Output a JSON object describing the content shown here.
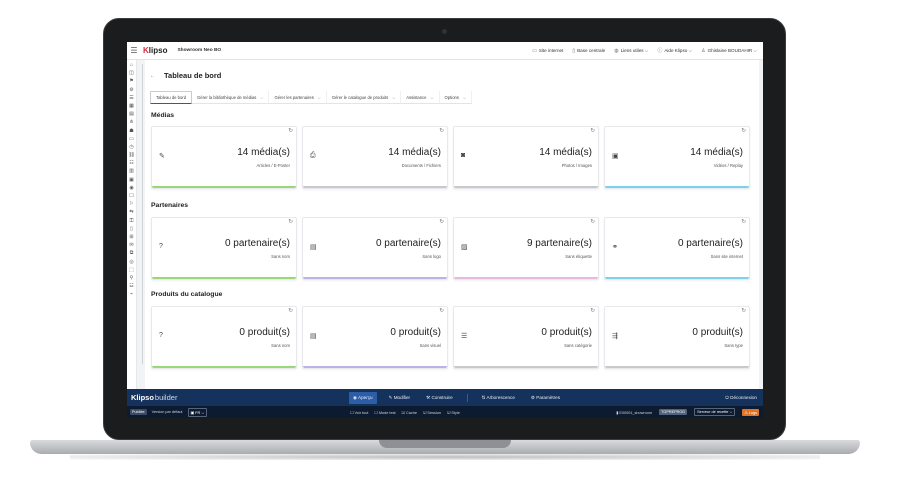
{
  "topbar": {
    "logo_k": "K",
    "logo_rest": "lipso",
    "site_name": "Showroom Neo BO",
    "links": [
      {
        "icon": "monitor-icon",
        "glyph": "▭",
        "label": "Site internet"
      },
      {
        "icon": "file-icon",
        "glyph": "▯",
        "label": "Base centrale"
      },
      {
        "icon": "globe-icon",
        "glyph": "◍",
        "label": "Liens utiles ⌵"
      },
      {
        "icon": "help-icon",
        "glyph": "ⓘ",
        "label": "Aide Klipso ⌵"
      },
      {
        "icon": "user-icon",
        "glyph": "♙",
        "label": "Ghislaine BOUDAHIR ⌵"
      }
    ]
  },
  "page": {
    "back_glyph": "←",
    "title": "Tableau de bord",
    "tabs": [
      {
        "label": "Tableau de bord",
        "active": true,
        "chevron": ""
      },
      {
        "label": "Gérer la bibliothèque de médias",
        "active": false,
        "chevron": "⌵"
      },
      {
        "label": "Gérer les partenaires",
        "active": false,
        "chevron": "⌵"
      },
      {
        "label": "Gérer le catalogue de produits",
        "active": false,
        "chevron": "⌵"
      },
      {
        "label": "Assistance",
        "active": false,
        "chevron": "⌵"
      },
      {
        "label": "Options",
        "active": false,
        "chevron": "⌵"
      }
    ]
  },
  "sections": [
    {
      "title": "Médias",
      "cards": [
        {
          "icon": "document-edit-icon",
          "glyph": "✎",
          "count": "14 média(s)",
          "sub": "Articles / E-Poster",
          "color": "#9bd77a"
        },
        {
          "icon": "file-search-icon",
          "glyph": "⎙",
          "count": "14 média(s)",
          "sub": "Documents / Fichiers",
          "color": "#c8c9cc"
        },
        {
          "icon": "camera-icon",
          "glyph": "◙",
          "count": "14 média(s)",
          "sub": "Photos / Images",
          "color": "#c8c9cc"
        },
        {
          "icon": "video-icon",
          "glyph": "▣",
          "count": "14 média(s)",
          "sub": "Vidéos / Replay",
          "color": "#7dd1ea"
        }
      ]
    },
    {
      "title": "Partenaires",
      "cards": [
        {
          "icon": "question-icon",
          "glyph": "?",
          "count": "0 partenaire(s)",
          "sub": "Sans nom",
          "color": "#9bd77a"
        },
        {
          "icon": "image-edit-icon",
          "glyph": "▤",
          "count": "0 partenaire(s)",
          "sub": "Sans logo",
          "color": "#b9b3e8"
        },
        {
          "icon": "no-image-icon",
          "glyph": "▨",
          "count": "9 partenaire(s)",
          "sub": "Sans étiquette",
          "color": "#e8b9e0"
        },
        {
          "icon": "link-off-icon",
          "glyph": "⚭",
          "count": "0 partenaire(s)",
          "sub": "Sans site internet",
          "color": "#7dd1ea"
        }
      ]
    },
    {
      "title": "Produits du catalogue",
      "cards": [
        {
          "icon": "question-icon",
          "glyph": "?",
          "count": "0 produit(s)",
          "sub": "Sans nom",
          "color": "#9bd77a"
        },
        {
          "icon": "image-edit-icon",
          "glyph": "▤",
          "count": "0 produit(s)",
          "sub": "Sans visuel",
          "color": "#b9b3e8"
        },
        {
          "icon": "list-icon",
          "glyph": "☰",
          "count": "0 produit(s)",
          "sub": "Sans catégorie",
          "color": "#c8c9cc"
        },
        {
          "icon": "type-icon",
          "glyph": "⇶",
          "count": "0 produit(s)",
          "sub": "Sans type",
          "color": "#c8c9cc"
        }
      ]
    }
  ],
  "refresh_glyph": "↻",
  "builder": {
    "logo_k": "Klipso",
    "logo_rest": "builder",
    "nav": [
      {
        "label": "◉ Aperçu",
        "active": true
      },
      {
        "label": "✎ Modifier",
        "active": false
      },
      {
        "label": "⚒ Construire",
        "active": false
      },
      {
        "label": "⇅ Arborescence",
        "active": false
      },
      {
        "label": "⚙ Paramètres",
        "active": false
      }
    ],
    "logout": "⏻ Déconnexion"
  },
  "status": {
    "published": "Publiée",
    "version": "Version par défaut",
    "lang": "▣ FR ⌵",
    "options": [
      "☐ Voir tout",
      "☐ Mode test",
      "☑ Cache",
      "☑ Session",
      "☑ Style"
    ],
    "site_id": "▮ E00001_showroom",
    "env": "TGPREPROD",
    "server": "Serveur de recette ⌵",
    "logs": "⚠ Logs"
  },
  "sidebar_icons": [
    "⌂",
    "◫",
    "⚑",
    "⚙",
    "☰",
    "▦",
    "▤",
    "⋔",
    "☗",
    "▭",
    "◷",
    "⛓",
    "☷",
    "▥",
    "▣",
    "◉",
    "☐",
    "⚐",
    "⇆",
    "⚿",
    "▯",
    "⊞",
    "✉",
    "⧉",
    "◎",
    "⬚",
    "⚲",
    "☳",
    "⌁"
  ]
}
